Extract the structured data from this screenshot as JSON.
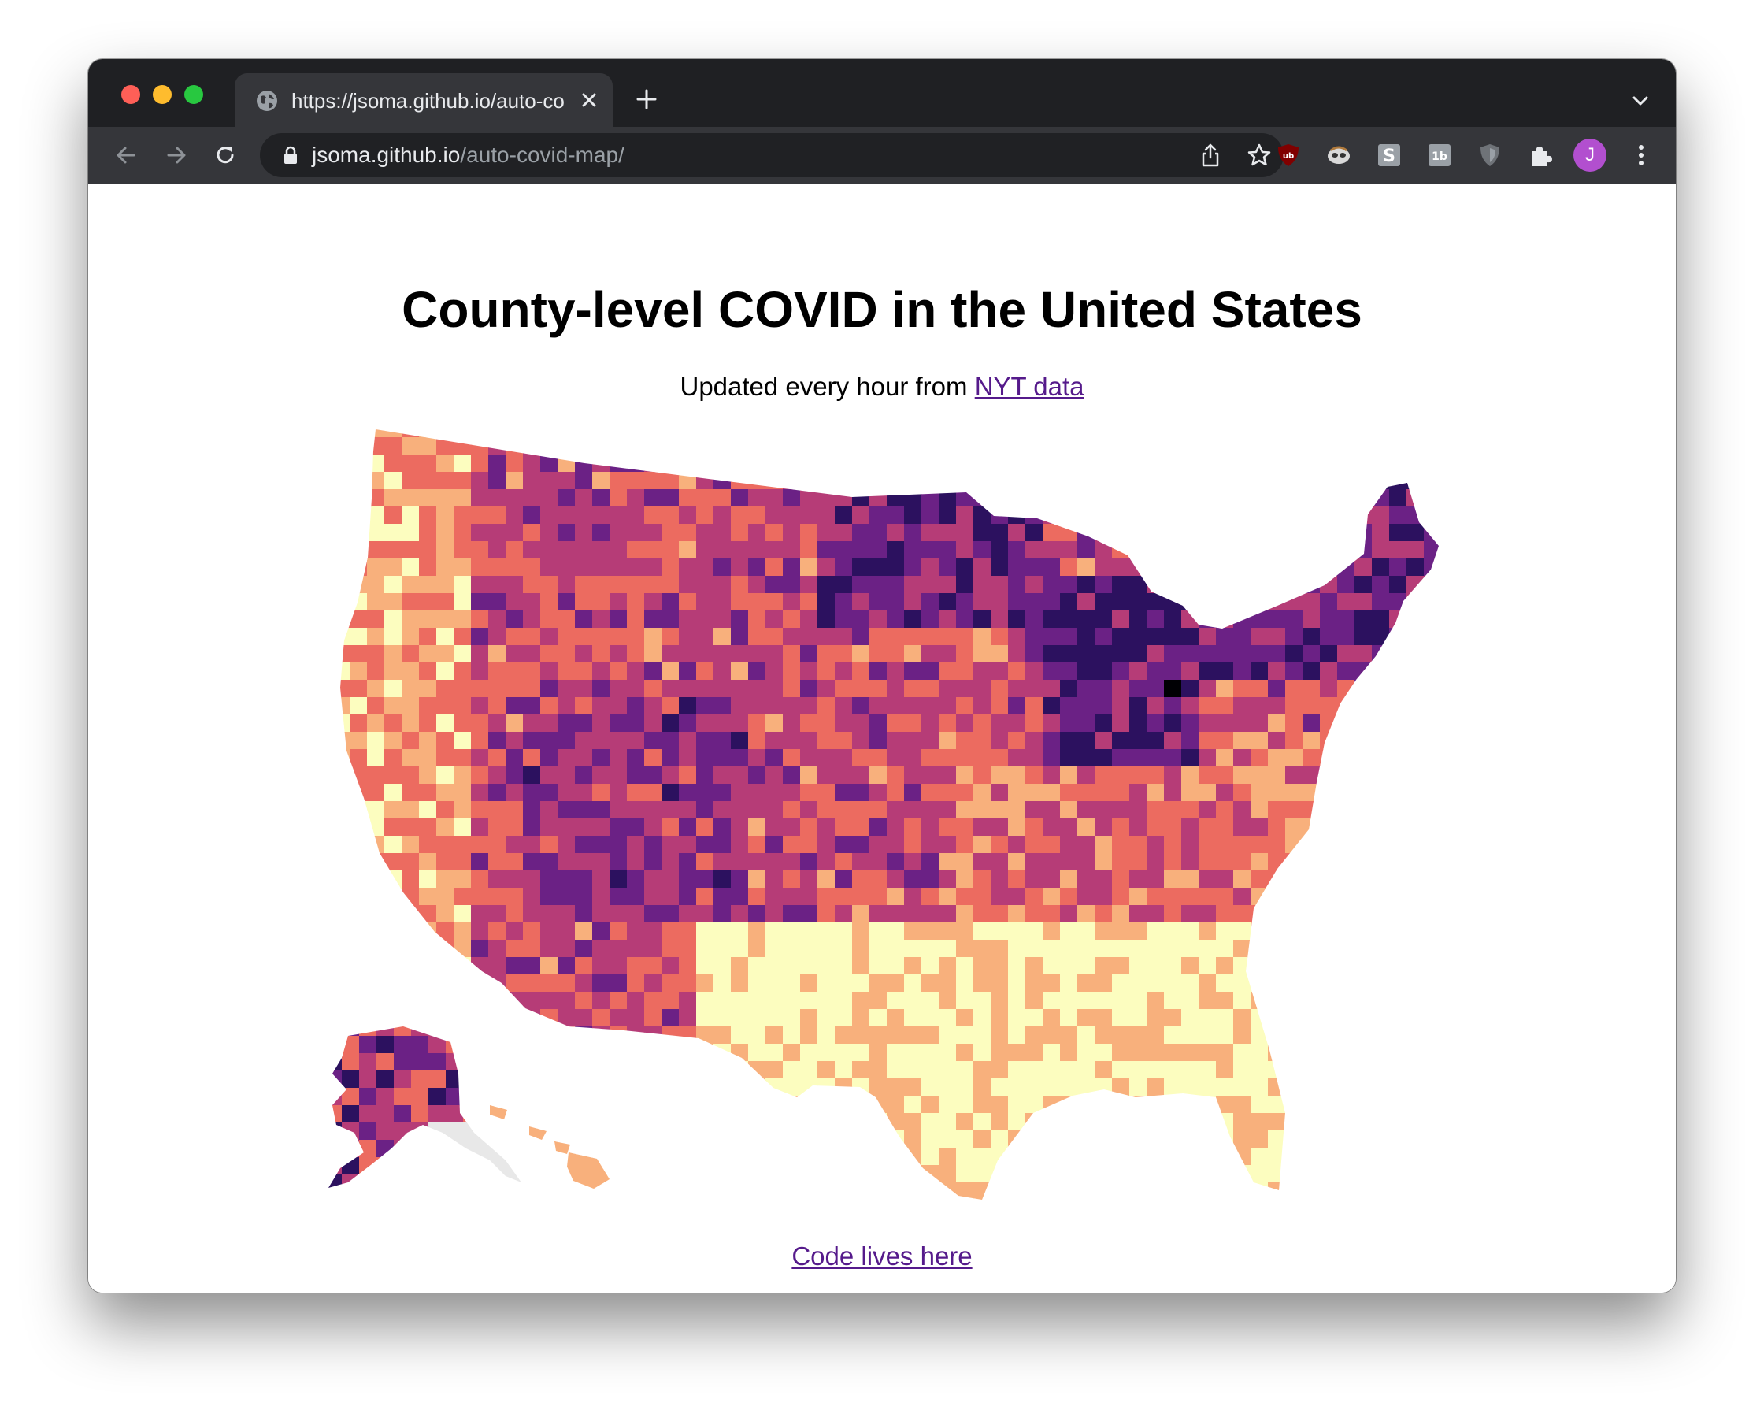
{
  "browser": {
    "tab": {
      "title": "https://jsoma.github.io/auto-co"
    },
    "url": {
      "host": "jsoma.github.io",
      "path": "/auto-covid-map/"
    },
    "profile_initial": "J",
    "extensions": [
      "ublock-origin-icon",
      "tampermonkey-icon",
      "s-extension-icon",
      "1b-extension-icon",
      "shield-extension-icon",
      "puzzle-extensions-icon"
    ]
  },
  "page": {
    "title": "County-level COVID in the United States",
    "subtitle_prefix": "Updated every hour from",
    "subtitle_link": "NYT data",
    "footer_link": "Code lives here"
  },
  "map": {
    "colors": {
      "very_low": "#fcfdbf",
      "low": "#f8b07c",
      "medium_low": "#ec6b60",
      "medium": "#b63c77",
      "high": "#6b2185",
      "very_high": "#2c115f",
      "extreme": "#000004",
      "no_data": "#e8e8e8"
    }
  }
}
